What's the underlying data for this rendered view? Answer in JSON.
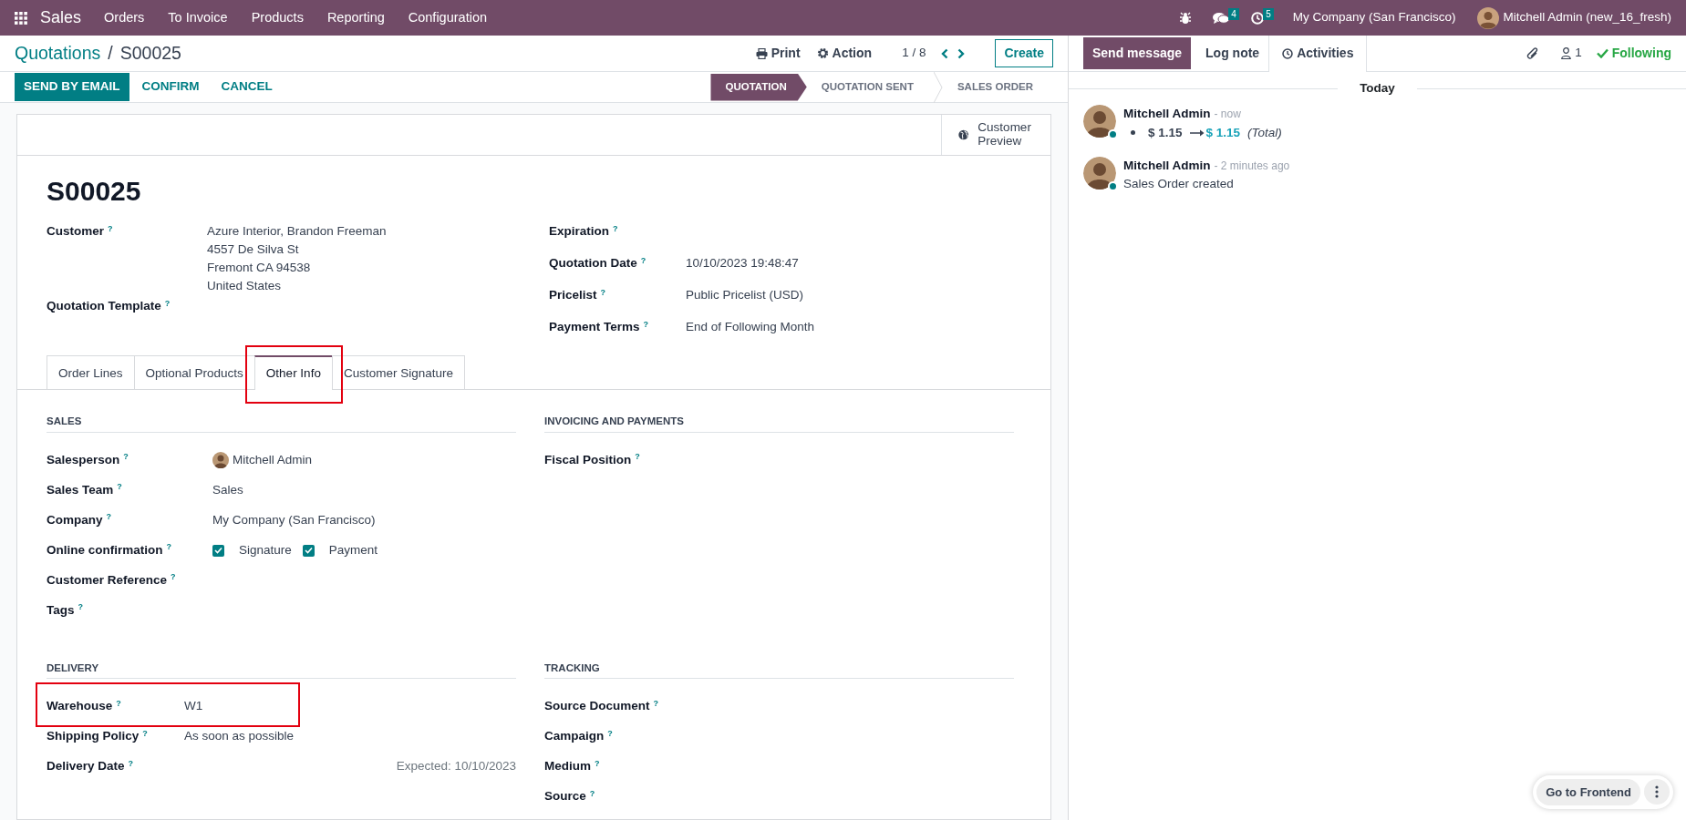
{
  "topbar": {
    "app": "Sales",
    "menu": [
      "Orders",
      "To Invoice",
      "Products",
      "Reporting",
      "Configuration"
    ],
    "messages_count": "4",
    "activities_count": "5",
    "company": "My Company (San Francisco)",
    "user": "Mitchell Admin (new_16_fresh)"
  },
  "breadcrumb": {
    "parent": "Quotations",
    "separator": "/",
    "current": "S00025"
  },
  "toolbar": {
    "print": "Print",
    "action": "Action",
    "pager": "1 / 8",
    "create": "Create"
  },
  "actions": [
    {
      "label": "SEND BY EMAIL",
      "primary": true
    },
    {
      "label": "CONFIRM",
      "primary": false
    },
    {
      "label": "CANCEL",
      "primary": false
    }
  ],
  "statusbar": [
    {
      "label": "QUOTATION",
      "selected": true
    },
    {
      "label": "QUOTATION SENT",
      "selected": false
    },
    {
      "label": "SALES ORDER",
      "selected": false
    }
  ],
  "smart_button": "Customer Preview",
  "record_name": "S00025",
  "left_fields": [
    {
      "label": "Customer$^{?}$",
      "lines": [
        "Azure Interior, Brandon Freeman",
        "4557 De Silva St",
        "Fremont CA 94538",
        "United States"
      ]
    },
    {
      "label": "Quotation Template$^{?}$"
    }
  ],
  "right_fields": [
    {
      "label": "Expiration$^{?}$"
    },
    {
      "label": "Quotation Date$^{?}$",
      "lines": [
        "10/10/2023 19:48:47"
      ]
    },
    {
      "label": "Pricelist$^{?}$",
      "lines": [
        "Public Pricelist (USD)"
      ]
    },
    {
      "label": "Payment Terms$^{?}$",
      "lines": [
        "End of Following Month"
      ]
    }
  ],
  "tabs": [
    {
      "label": "Order Lines",
      "selected": false,
      "highlighted": false
    },
    {
      "label": "Optional Products",
      "selected": false,
      "highlighted": false
    },
    {
      "label": "Other Info",
      "selected": true,
      "highlighted": true
    },
    {
      "label": "Customer Signature",
      "selected": false,
      "highlighted": false
    }
  ],
  "sections": [
    {
      "title": "SALES",
      "fields": [
        {
          "label": "Salesperson$^{?}$",
          "kind": "avatar",
          "value": "Mitchell Admin",
          "highlighted": false
        },
        {
          "label": "Sales Team$^{?}$",
          "kind": "text",
          "value": "Sales",
          "highlighted": false
        },
        {
          "label": "Company$^{?}$",
          "kind": "text",
          "value": "My Company (San Francisco)",
          "highlighted": false
        },
        {
          "label": "Online confirmation$^{?}$",
          "kind": "checks",
          "checks": [
            {
              "label": "Signature",
              "checked": true
            },
            {
              "label": "Payment",
              "checked": true
            }
          ],
          "highlighted": false
        },
        {
          "label": "Customer Reference$^{?}$",
          "kind": "text",
          "highlighted": false
        },
        {
          "label": "Tags$^{?}$",
          "kind": "text",
          "highlighted": false
        }
      ]
    },
    {
      "title": "INVOICING AND PAYMENTS",
      "fields": [
        {
          "label": "Fiscal Position$^{?}$",
          "kind": "text",
          "highlighted": false
        }
      ]
    },
    {
      "title": "DELIVERY",
      "fields": [
        {
          "label": "Warehouse$^{?}$",
          "kind": "text",
          "value": "W1",
          "highlighted": true
        },
        {
          "label": "Shipping Policy$^{?}$",
          "kind": "text",
          "value": "As soon as possible",
          "highlighted": false
        },
        {
          "label": "Delivery Date$^{?}$",
          "kind": "note",
          "note": "Expected: 10/10/2023",
          "highlighted": false
        }
      ]
    },
    {
      "title": "TRACKING",
      "fields": [
        {
          "label": "Source Document$^{?}$",
          "kind": "text",
          "highlighted": false
        },
        {
          "label": "Campaign$^{?}$",
          "kind": "text",
          "highlighted": false
        },
        {
          "label": "Medium$^{?}$",
          "kind": "text",
          "highlighted": false
        },
        {
          "label": "Source$^{?}$",
          "kind": "text",
          "highlighted": false
        }
      ]
    }
  ],
  "chatter": {
    "buttons": [
      {
        "label": "Send message",
        "selected": true
      },
      {
        "label": "Log note",
        "selected": false
      },
      {
        "label": "Activities",
        "selected": false
      }
    ],
    "followers": "1",
    "following": "Following",
    "day": "Today",
    "messages": [
      {
        "author": "Mitchell Admin",
        "time": "- now",
        "online": true,
        "kind": "tracking",
        "old": "$ 1.15",
        "new": "$ 1.15",
        "field": "(Total)"
      },
      {
        "author": "Mitchell Admin",
        "time": "- 2 minutes ago",
        "online": true,
        "kind": "text",
        "body": "Sales Order created"
      }
    ]
  },
  "frontend_button": "Go to Frontend"
}
